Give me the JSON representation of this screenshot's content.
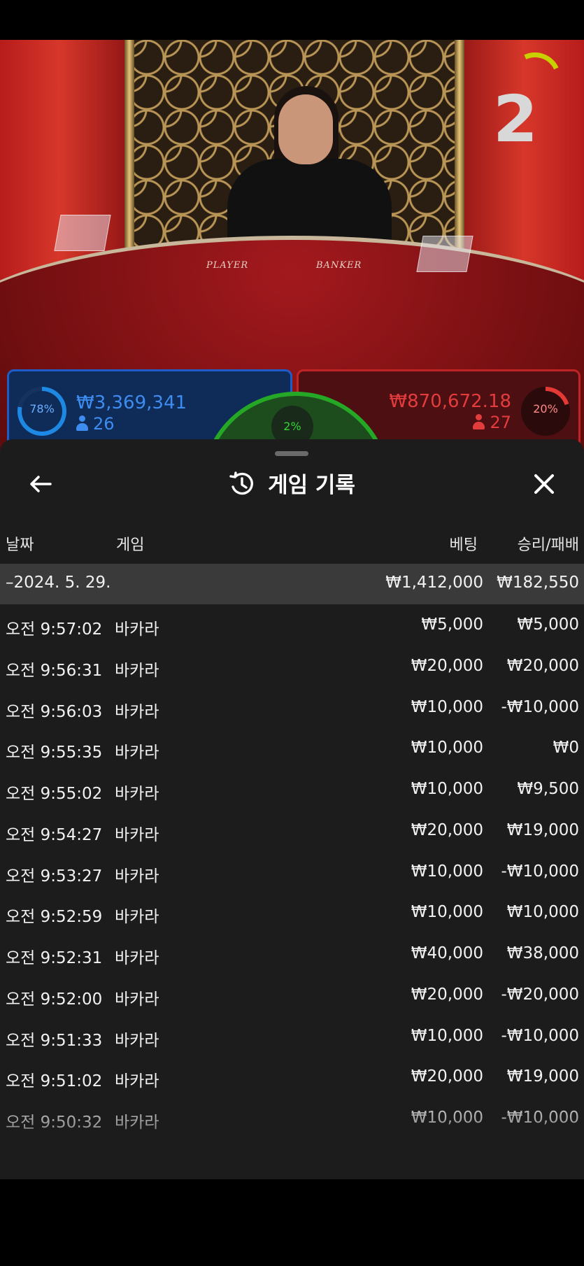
{
  "stream": {
    "round_number": "2",
    "felt_player": "PLAYER",
    "felt_banker": "BANKER"
  },
  "stats": {
    "player": {
      "percent": "78%",
      "amount": "₩3,369,341",
      "players": "26",
      "color": "#1e5cc8"
    },
    "banker": {
      "percent": "20%",
      "amount": "₩870,672.18",
      "players": "27",
      "color": "#c02424"
    },
    "tie": {
      "percent": "2%",
      "color": "#25a825"
    }
  },
  "history": {
    "title": "게임 기록",
    "columns": {
      "date": "날짜",
      "game": "게임",
      "bet": "베팅",
      "winloss": "승리/패배"
    },
    "day_summary": {
      "date": "–2024. 5. 29.",
      "bet": "₩1,412,000",
      "winloss": "₩182,550"
    },
    "rows": [
      {
        "time": "오전 9:57:02",
        "game": "바카라",
        "bet": "₩5,000",
        "winloss": "₩5,000"
      },
      {
        "time": "오전 9:56:31",
        "game": "바카라",
        "bet": "₩20,000",
        "winloss": "₩20,000"
      },
      {
        "time": "오전 9:56:03",
        "game": "바카라",
        "bet": "₩10,000",
        "winloss": "-₩10,000"
      },
      {
        "time": "오전 9:55:35",
        "game": "바카라",
        "bet": "₩10,000",
        "winloss": "₩0"
      },
      {
        "time": "오전 9:55:02",
        "game": "바카라",
        "bet": "₩10,000",
        "winloss": "₩9,500"
      },
      {
        "time": "오전 9:54:27",
        "game": "바카라",
        "bet": "₩20,000",
        "winloss": "₩19,000"
      },
      {
        "time": "오전 9:53:27",
        "game": "바카라",
        "bet": "₩10,000",
        "winloss": "-₩10,000"
      },
      {
        "time": "오전 9:52:59",
        "game": "바카라",
        "bet": "₩10,000",
        "winloss": "₩10,000"
      },
      {
        "time": "오전 9:52:31",
        "game": "바카라",
        "bet": "₩40,000",
        "winloss": "₩38,000"
      },
      {
        "time": "오전 9:52:00",
        "game": "바카라",
        "bet": "₩20,000",
        "winloss": "-₩20,000"
      },
      {
        "time": "오전 9:51:33",
        "game": "바카라",
        "bet": "₩10,000",
        "winloss": "-₩10,000"
      },
      {
        "time": "오전 9:51:02",
        "game": "바카라",
        "bet": "₩20,000",
        "winloss": "₩19,000"
      },
      {
        "time": "오전 9:50:32",
        "game": "바카라",
        "bet": "₩10,000",
        "winloss": "-₩10,000"
      }
    ]
  }
}
